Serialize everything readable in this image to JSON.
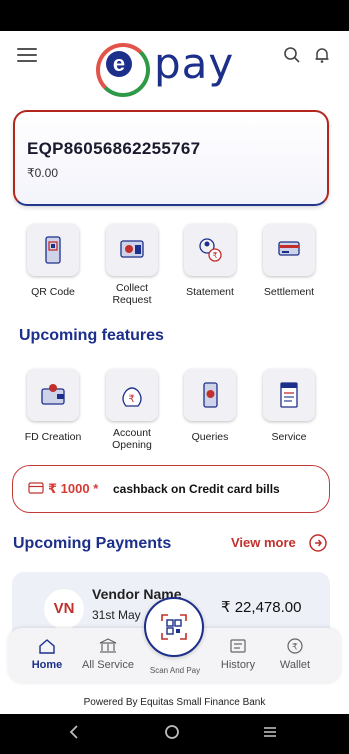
{
  "header": {
    "logo_text": "pay",
    "logo_letter": "e"
  },
  "account": {
    "number": "EQP86056862255767",
    "balance": "₹0.00"
  },
  "services": [
    {
      "label": "QR Code"
    },
    {
      "label": "Collect Request"
    },
    {
      "label": "Statement"
    },
    {
      "label": "Settlement"
    }
  ],
  "upcoming_features": {
    "title": "Upcoming features",
    "items": [
      {
        "label": "FD Creation"
      },
      {
        "label": "Account Opening"
      },
      {
        "label": "Queries"
      },
      {
        "label": "Service"
      }
    ]
  },
  "promo": {
    "amount": "₹ 1000 *",
    "text": "cashback on Credit card bills"
  },
  "upcoming_payments": {
    "title": "Upcoming Payments",
    "view_more": "View more",
    "vendor_initials": "VN",
    "vendor_name": "Vendor Name",
    "vendor_date": "31st May",
    "vendor_amount": "₹ 22,478.00"
  },
  "bottom_nav": {
    "home": "Home",
    "all_service": "All Service",
    "scan": "Scan And Pay",
    "history": "History",
    "wallet": "Wallet"
  },
  "footer": "Powered By Equitas Small Finance Bank",
  "colors": {
    "brand_blue": "#1c2f8a",
    "brand_red": "#c1302c",
    "brand_green": "#2e9a47"
  }
}
